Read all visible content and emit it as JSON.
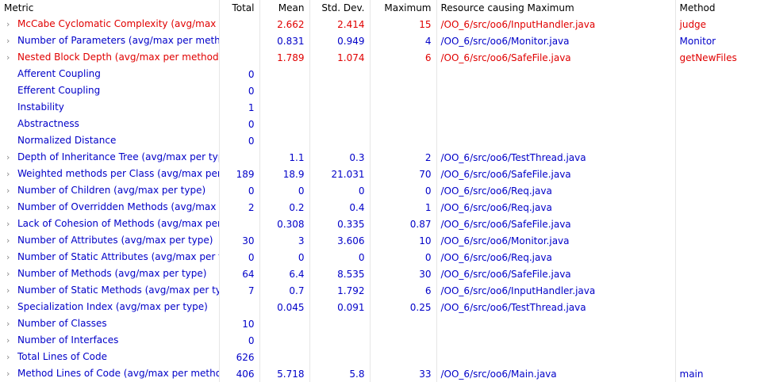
{
  "headers": [
    "Metric",
    "Total",
    "Mean",
    "Std. Dev.",
    "Maximum",
    "Resource causing Maximum",
    "Method"
  ],
  "chevron_glyph": "›",
  "rows": [
    {
      "metric": "McCabe Cyclomatic Complexity (avg/max per method)",
      "total": "",
      "mean": "2.662",
      "std": "2.414",
      "max": "15",
      "resource": "/OO_6/src/oo6/InputHandler.java",
      "method": "judge",
      "warn": true,
      "expandable": true
    },
    {
      "metric": "Number of Parameters (avg/max per method)",
      "total": "",
      "mean": "0.831",
      "std": "0.949",
      "max": "4",
      "resource": "/OO_6/src/oo6/Monitor.java",
      "method": "Monitor",
      "warn": false,
      "expandable": true
    },
    {
      "metric": "Nested Block Depth (avg/max per method)",
      "total": "",
      "mean": "1.789",
      "std": "1.074",
      "max": "6",
      "resource": "/OO_6/src/oo6/SafeFile.java",
      "method": "getNewFiles",
      "warn": true,
      "expandable": true
    },
    {
      "metric": "Afferent Coupling",
      "total": "0",
      "mean": "",
      "std": "",
      "max": "",
      "resource": "",
      "method": "",
      "warn": false,
      "expandable": false
    },
    {
      "metric": "Efferent Coupling",
      "total": "0",
      "mean": "",
      "std": "",
      "max": "",
      "resource": "",
      "method": "",
      "warn": false,
      "expandable": false
    },
    {
      "metric": "Instability",
      "total": "1",
      "mean": "",
      "std": "",
      "max": "",
      "resource": "",
      "method": "",
      "warn": false,
      "expandable": false
    },
    {
      "metric": "Abstractness",
      "total": "0",
      "mean": "",
      "std": "",
      "max": "",
      "resource": "",
      "method": "",
      "warn": false,
      "expandable": false
    },
    {
      "metric": "Normalized Distance",
      "total": "0",
      "mean": "",
      "std": "",
      "max": "",
      "resource": "",
      "method": "",
      "warn": false,
      "expandable": false
    },
    {
      "metric": "Depth of Inheritance Tree (avg/max per type)",
      "total": "",
      "mean": "1.1",
      "std": "0.3",
      "max": "2",
      "resource": "/OO_6/src/oo6/TestThread.java",
      "method": "",
      "warn": false,
      "expandable": true
    },
    {
      "metric": "Weighted methods per Class (avg/max per type)",
      "total": "189",
      "mean": "18.9",
      "std": "21.031",
      "max": "70",
      "resource": "/OO_6/src/oo6/SafeFile.java",
      "method": "",
      "warn": false,
      "expandable": true
    },
    {
      "metric": "Number of Children (avg/max per type)",
      "total": "0",
      "mean": "0",
      "std": "0",
      "max": "0",
      "resource": "/OO_6/src/oo6/Req.java",
      "method": "",
      "warn": false,
      "expandable": true
    },
    {
      "metric": "Number of Overridden Methods (avg/max per type)",
      "total": "2",
      "mean": "0.2",
      "std": "0.4",
      "max": "1",
      "resource": "/OO_6/src/oo6/Req.java",
      "method": "",
      "warn": false,
      "expandable": true
    },
    {
      "metric": "Lack of Cohesion of Methods (avg/max per type)",
      "total": "",
      "mean": "0.308",
      "std": "0.335",
      "max": "0.87",
      "resource": "/OO_6/src/oo6/SafeFile.java",
      "method": "",
      "warn": false,
      "expandable": true
    },
    {
      "metric": "Number of Attributes (avg/max per type)",
      "total": "30",
      "mean": "3",
      "std": "3.606",
      "max": "10",
      "resource": "/OO_6/src/oo6/Monitor.java",
      "method": "",
      "warn": false,
      "expandable": true
    },
    {
      "metric": "Number of Static Attributes (avg/max per type)",
      "total": "0",
      "mean": "0",
      "std": "0",
      "max": "0",
      "resource": "/OO_6/src/oo6/Req.java",
      "method": "",
      "warn": false,
      "expandable": true
    },
    {
      "metric": "Number of Methods (avg/max per type)",
      "total": "64",
      "mean": "6.4",
      "std": "8.535",
      "max": "30",
      "resource": "/OO_6/src/oo6/SafeFile.java",
      "method": "",
      "warn": false,
      "expandable": true
    },
    {
      "metric": "Number of Static Methods (avg/max per type)",
      "total": "7",
      "mean": "0.7",
      "std": "1.792",
      "max": "6",
      "resource": "/OO_6/src/oo6/InputHandler.java",
      "method": "",
      "warn": false,
      "expandable": true
    },
    {
      "metric": "Specialization Index (avg/max per type)",
      "total": "",
      "mean": "0.045",
      "std": "0.091",
      "max": "0.25",
      "resource": "/OO_6/src/oo6/TestThread.java",
      "method": "",
      "warn": false,
      "expandable": true
    },
    {
      "metric": "Number of Classes",
      "total": "10",
      "mean": "",
      "std": "",
      "max": "",
      "resource": "",
      "method": "",
      "warn": false,
      "expandable": true
    },
    {
      "metric": "Number of Interfaces",
      "total": "0",
      "mean": "",
      "std": "",
      "max": "",
      "resource": "",
      "method": "",
      "warn": false,
      "expandable": true
    },
    {
      "metric": "Total Lines of Code",
      "total": "626",
      "mean": "",
      "std": "",
      "max": "",
      "resource": "",
      "method": "",
      "warn": false,
      "expandable": true
    },
    {
      "metric": "Method Lines of Code (avg/max per method)",
      "total": "406",
      "mean": "5.718",
      "std": "5.8",
      "max": "33",
      "resource": "/OO_6/src/oo6/Main.java",
      "method": "main",
      "warn": false,
      "expandable": true
    }
  ],
  "colors": {
    "normal_text": "#0000c8",
    "warning_text": "#e00000",
    "header_text": "#000000",
    "grid_line": "#e6e6e6"
  }
}
